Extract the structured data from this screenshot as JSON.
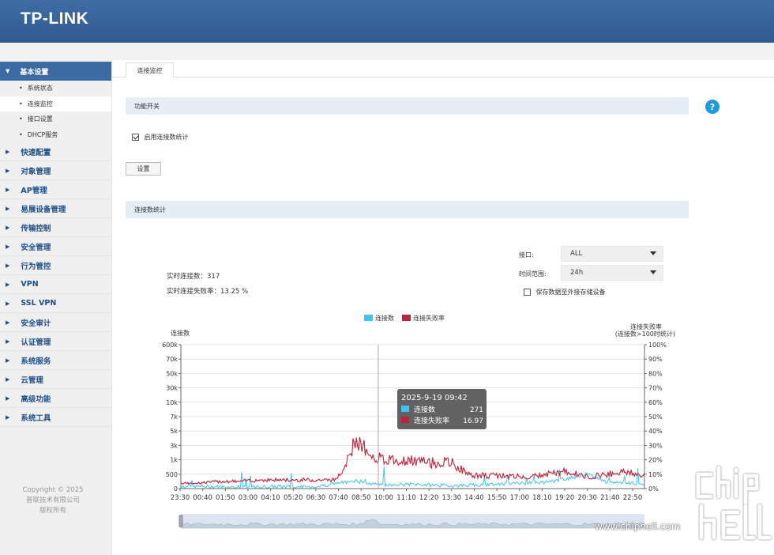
{
  "brand": {
    "logo": "TP-LINK"
  },
  "sidebar": {
    "active_group": "基本设置",
    "sub_items": [
      {
        "label": "系统状态",
        "active": false
      },
      {
        "label": "连接监控",
        "active": true
      },
      {
        "label": "接口设置",
        "active": false
      },
      {
        "label": "DHCP服务",
        "active": false
      }
    ],
    "items": [
      "快速配置",
      "对象管理",
      "AP管理",
      "易展设备管理",
      "传输控制",
      "安全管理",
      "行为管控",
      "VPN",
      "SSL VPN",
      "安全审计",
      "认证管理",
      "系统服务",
      "云管理",
      "高级功能",
      "系统工具"
    ],
    "copyright": [
      "Copyright © 2025",
      "普联技术有限公司",
      "版权所有"
    ]
  },
  "main": {
    "tab": "连接监控",
    "section1": "功能开关",
    "enable_label": "启用连接数统计",
    "enable_checked": true,
    "set_button": "设置",
    "section2": "连接数统计",
    "interface_label": "接口:",
    "interface_value": "ALL",
    "range_label": "时间范围:",
    "range_value": "24h",
    "save_ext_label": "保存数据至外接存储设备",
    "save_ext_checked": false,
    "realtime_conn": "实时连接数：317",
    "realtime_fail": "实时连接失败率：13.25 %"
  },
  "chart_data": {
    "type": "line",
    "title": "",
    "legend": [
      "连接数",
      "连接失败率"
    ],
    "legend_position": "top-center",
    "ylabel_left": "连接数",
    "ylabel_right": [
      "连接失败率",
      "(连接数>100时统计)"
    ],
    "left_ticks": [
      "0",
      "500",
      "1k",
      "3k",
      "5k",
      "7k",
      "10k",
      "30k",
      "50k",
      "70k",
      "600k"
    ],
    "right_ticks": [
      "0%",
      "10%",
      "20%",
      "30%",
      "40%",
      "50%",
      "60%",
      "70%",
      "80%",
      "90%",
      "100%"
    ],
    "x_ticks": [
      "23:30",
      "00:40",
      "01:50",
      "03:00",
      "04:10",
      "05:20",
      "06:30",
      "07:40",
      "08:50",
      "10:00",
      "11:10",
      "12:20",
      "13:30",
      "14:40",
      "15:50",
      "17:00",
      "18:10",
      "19:20",
      "20:30",
      "21:40",
      "22:50"
    ],
    "grid": true,
    "series": [
      {
        "name": "连接数",
        "color": "#3fc4f0",
        "tick_index_samples": [
          0.1,
          0.15,
          0.12,
          0.1,
          0.1,
          0.15,
          0.12,
          0.13,
          0.35,
          0.55,
          0.3,
          0.25,
          0.3,
          0.25,
          0.2,
          0.25,
          0.3,
          0.35,
          0.4,
          0.45,
          0.7,
          1.0,
          0.5,
          0.4,
          0.3
        ]
      },
      {
        "name": "连接失败率",
        "color": "#c0203a",
        "percent_samples": [
          4,
          4,
          5,
          5,
          6,
          6,
          6,
          6,
          6,
          28,
          22,
          20,
          19,
          18,
          18,
          9,
          9,
          9,
          8,
          10,
          12,
          8,
          10,
          12,
          9
        ]
      }
    ],
    "tooltip": {
      "time": "2025-9-19 09:42",
      "rows": [
        {
          "name": "连接数",
          "value": "271"
        },
        {
          "name": "连接失败率",
          "value": "16.97"
        }
      ]
    },
    "watermark": "www.chiphell.com",
    "accent": "#3c6aa3"
  }
}
